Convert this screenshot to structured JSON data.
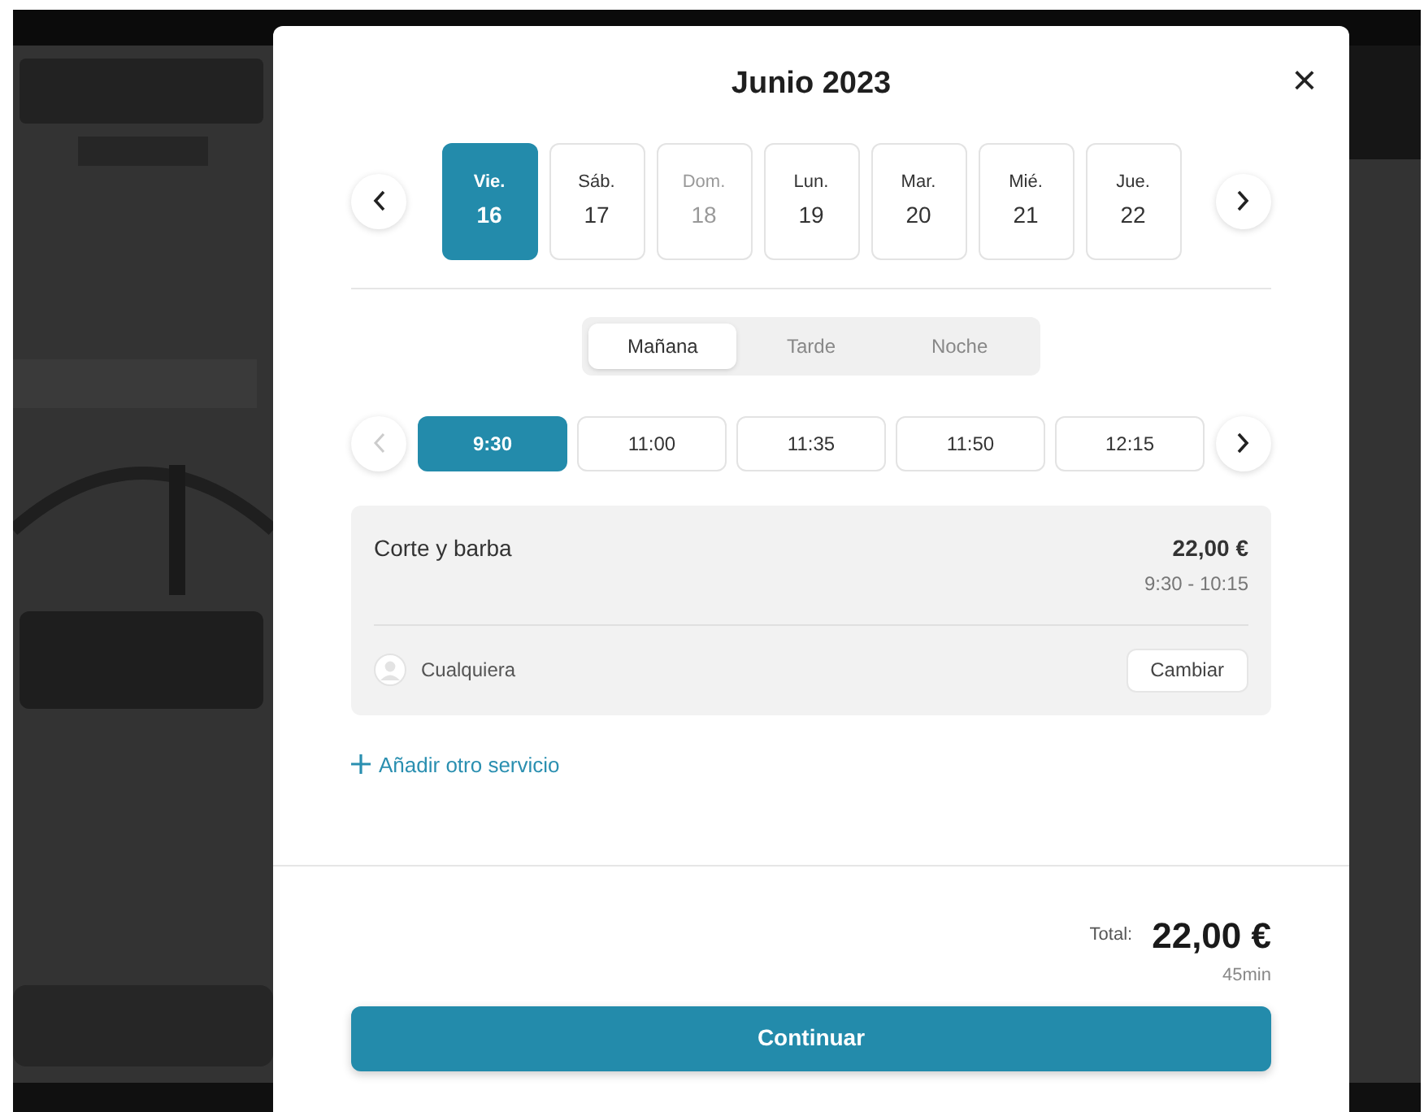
{
  "dialog": {
    "title": "Junio 2023",
    "close": "×"
  },
  "days": [
    {
      "weekday": "Vie.",
      "day": "16",
      "selected": true,
      "disabled": false
    },
    {
      "weekday": "Sáb.",
      "day": "17",
      "selected": false,
      "disabled": false
    },
    {
      "weekday": "Dom.",
      "day": "18",
      "selected": false,
      "disabled": true
    },
    {
      "weekday": "Lun.",
      "day": "19",
      "selected": false,
      "disabled": false
    },
    {
      "weekday": "Mar.",
      "day": "20",
      "selected": false,
      "disabled": false
    },
    {
      "weekday": "Mié.",
      "day": "21",
      "selected": false,
      "disabled": false
    },
    {
      "weekday": "Jue.",
      "day": "22",
      "selected": false,
      "disabled": false
    }
  ],
  "periods": [
    {
      "label": "Mañana",
      "selected": true
    },
    {
      "label": "Tarde",
      "selected": false
    },
    {
      "label": "Noche",
      "selected": false
    }
  ],
  "times": {
    "prev_disabled": true,
    "slots": [
      {
        "label": "9:30",
        "selected": true
      },
      {
        "label": "11:00",
        "selected": false
      },
      {
        "label": "11:35",
        "selected": false
      },
      {
        "label": "11:50",
        "selected": false
      },
      {
        "label": "12:15",
        "selected": false
      }
    ]
  },
  "service": {
    "name": "Corte y barba",
    "price": "22,00 €",
    "time": "9:30 - 10:15",
    "staff": "Cualquiera",
    "change": "Cambiar"
  },
  "add_service": "Añadir otro servicio",
  "total": {
    "label": "Total:",
    "amount": "22,00 €",
    "duration": "45min"
  },
  "continue": "Continuar"
}
